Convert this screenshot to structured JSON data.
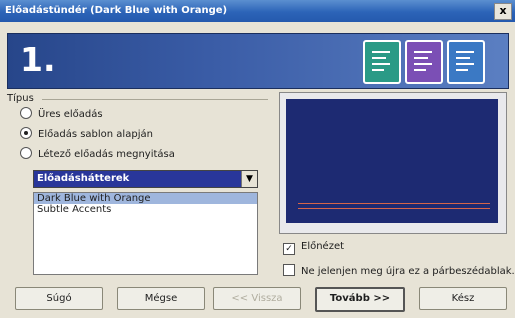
{
  "window": {
    "title": "Előadástündér (Dark Blue with Orange)",
    "close_label": "x"
  },
  "banner": {
    "step": "1."
  },
  "type_group": {
    "label": "Típus",
    "options": [
      {
        "label": "Üres előadás",
        "selected": false
      },
      {
        "label": "Előadás sablon alapján",
        "selected": true
      },
      {
        "label": "Létező előadás megnyitása",
        "selected": false
      }
    ]
  },
  "category_select": {
    "value": "Előadáshátterek"
  },
  "template_list": {
    "items": [
      "Dark Blue with Orange",
      "Subtle Accents"
    ],
    "selected": "Dark Blue with Orange"
  },
  "options": {
    "preview_label": "Előnézet",
    "preview_checked": true,
    "dont_show_label": "Ne jelenjen meg újra ez a párbeszédablak.",
    "dont_show_checked": false
  },
  "buttons": {
    "help": "Súgó",
    "cancel": "Mégse",
    "back": "<< Vissza",
    "next": "Tovább >>",
    "finish": "Kész"
  },
  "colors": {
    "banner": "#3a5ca6",
    "preview_slide": "#1d2a72",
    "preview_accent": "#d4654a",
    "selection": "#9fb6dd"
  }
}
